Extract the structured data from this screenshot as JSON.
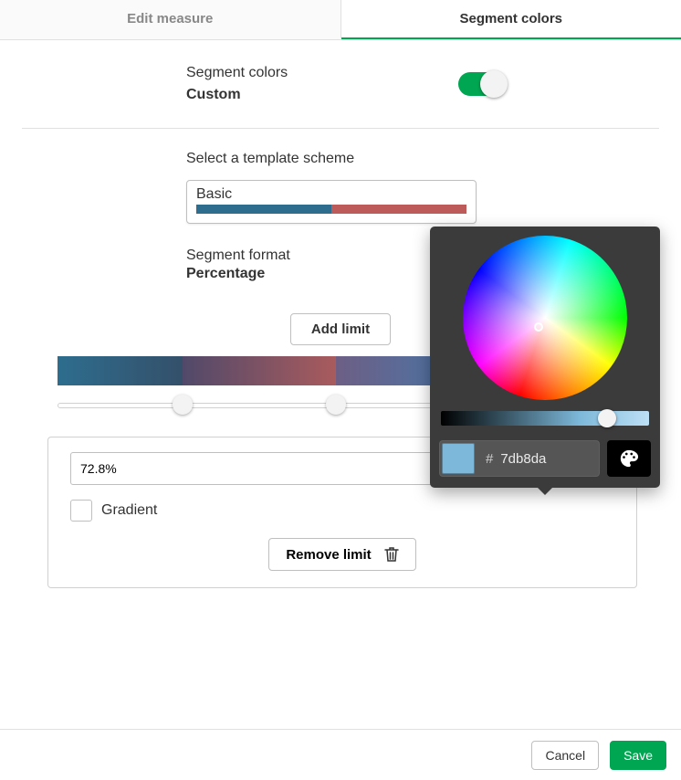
{
  "tabs": {
    "edit_measure": "Edit measure",
    "segment_colors": "Segment colors",
    "active": "segment_colors"
  },
  "segment_colors": {
    "title": "Segment colors",
    "mode": "Custom",
    "toggle_on": true
  },
  "template": {
    "label": "Select a template scheme",
    "selected_name": "Basic",
    "stops": [
      "#2e6d8e",
      "#bd5b5b"
    ]
  },
  "format": {
    "label": "Segment format",
    "value": "Percentage"
  },
  "buttons": {
    "add_limit": "Add limit",
    "remove_limit": "Remove limit",
    "cancel": "Cancel",
    "save": "Save"
  },
  "segments": {
    "colors": [
      "#2e6d8e",
      "#a95b5d",
      "#4876a8",
      "#7db8da"
    ],
    "limits_percent": [
      22.2,
      49.2,
      72.8
    ],
    "active_limit_index": 2
  },
  "limit_editor": {
    "value_text": "72.8%",
    "gradient_label": "Gradient",
    "gradient_checked": false
  },
  "color_picker": {
    "hex_prefix": "#",
    "hex_value": "7db8da",
    "lightness_pos_percent": 80,
    "icon_eyedropper": "palette-icon"
  }
}
